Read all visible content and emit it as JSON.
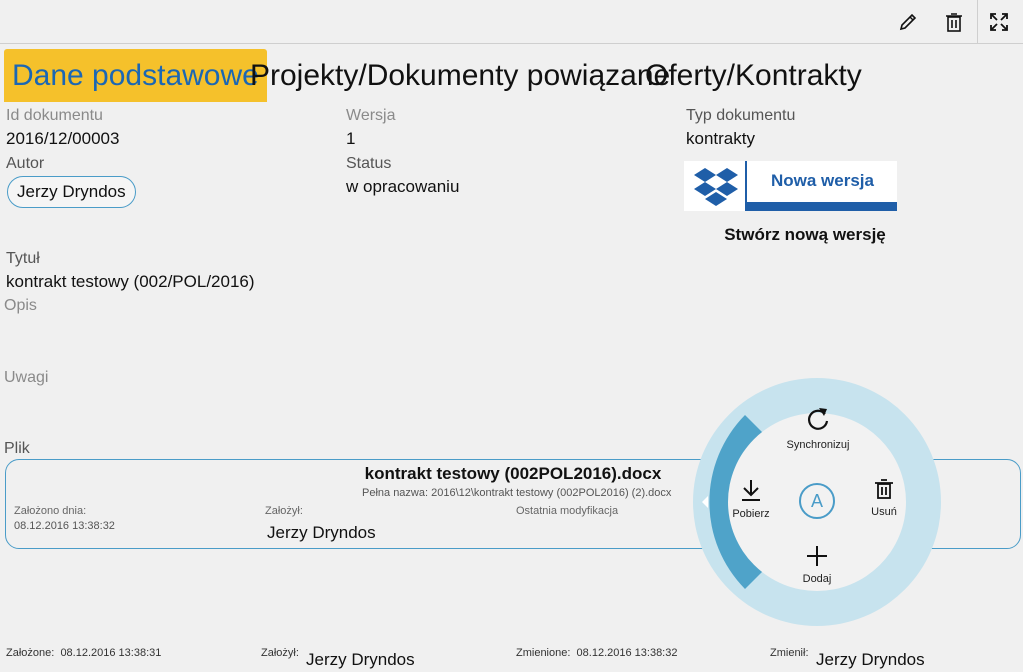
{
  "toolbar": {
    "edit_icon": "pencil-icon",
    "delete_icon": "trash-icon",
    "fullscreen_icon": "expand-icon"
  },
  "tabs": [
    {
      "label": "Dane podstawowe",
      "active": true
    },
    {
      "label": "Projekty/Dokumenty powiązane",
      "active": false
    },
    {
      "label": "Oferty/Kontrakty",
      "active": false
    }
  ],
  "fields": {
    "id_label": "Id dokumentu",
    "id_value": "2016/12/00003",
    "version_label": "Wersja",
    "version_value": "1",
    "type_label": "Typ dokumentu",
    "type_value": "kontrakty",
    "author_label": "Autor",
    "author_value": "Jerzy Dryndos",
    "status_label": "Status",
    "status_value": "w opracowaniu",
    "title_label": "Tytuł",
    "title_value": "kontrakt testowy (002/POL/2016)",
    "desc_label": "Opis",
    "notes_label": "Uwagi",
    "file_label": "Plik"
  },
  "new_version": {
    "button_label": "Nowa wersja",
    "caption": "Stwórz nową wersję",
    "icon": "dropbox-icon"
  },
  "file": {
    "name": "kontrakt testowy (002POL2016).docx",
    "full_name_label": "Pełna nazwa:",
    "full_name_value": "2016\\12\\kontrakt testowy (002POL2016) (2).docx",
    "created_label": "Założono dnia:",
    "created_value": "08.12.2016 13:38:32",
    "creator_label": "Założył:",
    "creator_value": "Jerzy Dryndos",
    "modified_label": "Ostatnia modyfikacja"
  },
  "radial_menu": {
    "sync": "Synchronizuj",
    "download": "Pobierz",
    "delete": "Usuń",
    "add": "Dodaj",
    "center": "A"
  },
  "footer": {
    "created_label": "Założone:",
    "created_value": "08.12.2016 13:38:31",
    "creator_label": "Założył:",
    "creator_value": "Jerzy Dryndos",
    "changed_label": "Zmienione:",
    "changed_value": "08.12.2016 13:38:32",
    "changer_label": "Zmienił:",
    "changer_value": "Jerzy Dryndos"
  },
  "colors": {
    "accent": "#f5c12b",
    "tab_active_text": "#1b67b4",
    "border_blue": "#4a9cc8",
    "dropbox_blue": "#1f5ea8",
    "radial_ring": "#c7e3ee",
    "radial_arc": "#4fa3c9"
  }
}
